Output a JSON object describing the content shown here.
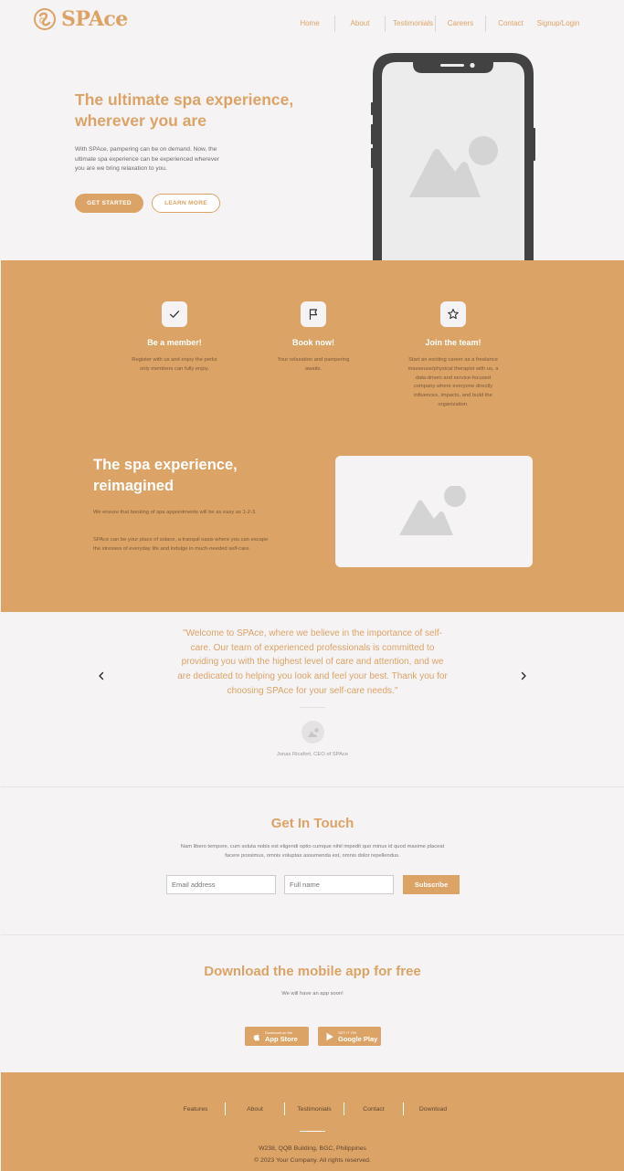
{
  "header": {
    "logo_text": "SPAce",
    "nav": [
      "Home",
      "About",
      "Testimonials",
      "Careers",
      "Contact",
      "Signup/Login"
    ]
  },
  "hero": {
    "title": "The ultimate spa experience, wherever you are",
    "description": "With SPAce, pampering can be on demand. Now, the ultimate spa experience can be experienced wherever you are we bring relaxation to you.",
    "primary_button": "GET STARTED",
    "secondary_button": "LEARN MORE"
  },
  "features": [
    {
      "icon": "check-icon",
      "title": "Be a member!",
      "text": "Register with us and enjoy the perks only members can fully enjoy."
    },
    {
      "icon": "flag-icon",
      "title": "Book now!",
      "text": "Your relaxation and pampering awaits."
    },
    {
      "icon": "star-icon",
      "title": "Join the team!",
      "text": "Start an exciting career as a freelance masseuse/physical therapist with us, a data-driven and service-focused company where everyone directly influences, impacts, and build the organization."
    }
  ],
  "spa": {
    "title": "The spa experience, reimagined",
    "paragraph1": "We ensure that booking of spa appointments will be as easy as 1-2-3.",
    "paragraph2": "SPAce can be your place of solace, a tranquil oasis where you can escape the stresses of everyday life and indulge in much-needed self-care."
  },
  "testimonial": {
    "quote": "\"Welcome to SPAce, where we believe in the importance of self-care. Our team of experienced professionals is committed to providing you with the highest level of care and attention, and we are dedicated to helping you look and feel your best. Thank you for choosing SPAce for your self-care needs.\"",
    "author": "Jonas Ricafort, CEO of SPAce"
  },
  "contact": {
    "title": "Get In Touch",
    "description": "Nam libero tempore, cum soluta nobis est eligendi optio cumque nihil impedit quo minus id quod maxime placeat facere possimus, omnis voluptas assumenda est, omnis dolor repellendus.",
    "email_placeholder": "Email address",
    "name_placeholder": "Full name",
    "subscribe_label": "Subscribe"
  },
  "download": {
    "title": "Download the mobile app for free",
    "subtitle": "We will have an app soon!",
    "app_store_small": "Download on the",
    "app_store_big": "App Store",
    "google_play_small": "GET IT ON",
    "google_play_big": "Google Play"
  },
  "footer": {
    "nav": [
      "Features",
      "About",
      "Testimonials",
      "Contact",
      "Download"
    ],
    "address": "W238, QQB Building, BGC, Philippines",
    "copyright": "© 2023 Your Company. All rights reserved."
  },
  "colors": {
    "accent": "#dca366",
    "background": "#f6f3f5",
    "phone_frame": "#424242"
  }
}
